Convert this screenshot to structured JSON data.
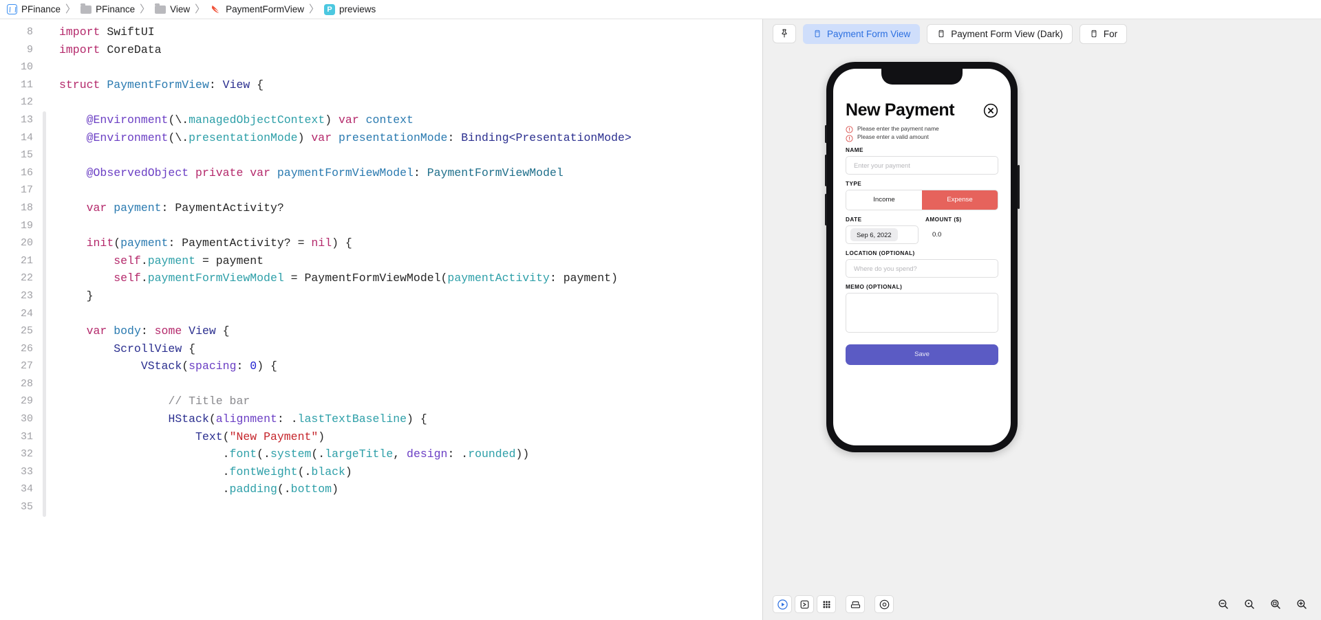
{
  "breadcrumb": {
    "items": [
      {
        "icon": "app-icon",
        "label": "PFinance"
      },
      {
        "icon": "folder-icon",
        "label": "PFinance"
      },
      {
        "icon": "folder-icon",
        "label": "View"
      },
      {
        "icon": "swift-icon",
        "label": "PaymentFormView"
      },
      {
        "icon": "preview-icon",
        "label": "previews"
      }
    ],
    "separator": "〉"
  },
  "editor": {
    "first_line_number": 8,
    "lines": [
      {
        "n": 8,
        "tokens": [
          {
            "t": "import",
            "c": "kw"
          },
          {
            "t": " SwiftUI",
            "c": "pln"
          }
        ]
      },
      {
        "n": 9,
        "tokens": [
          {
            "t": "import",
            "c": "kw"
          },
          {
            "t": " CoreData",
            "c": "pln"
          }
        ]
      },
      {
        "n": 10,
        "tokens": []
      },
      {
        "n": 11,
        "tokens": [
          {
            "t": "struct",
            "c": "kw"
          },
          {
            "t": " ",
            "c": "pln"
          },
          {
            "t": "PaymentFormView",
            "c": "var"
          },
          {
            "t": ": ",
            "c": "pln"
          },
          {
            "t": "View",
            "c": "typ"
          },
          {
            "t": " {",
            "c": "pln"
          }
        ]
      },
      {
        "n": 12,
        "tokens": []
      },
      {
        "n": 13,
        "tokens": [
          {
            "t": "    ",
            "c": "pln"
          },
          {
            "t": "@Environment",
            "c": "attr"
          },
          {
            "t": "(\\.",
            "c": "pln"
          },
          {
            "t": "managedObjectContext",
            "c": "prop"
          },
          {
            "t": ") ",
            "c": "pln"
          },
          {
            "t": "var",
            "c": "kw"
          },
          {
            "t": " ",
            "c": "pln"
          },
          {
            "t": "context",
            "c": "var"
          }
        ]
      },
      {
        "n": 14,
        "tokens": [
          {
            "t": "    ",
            "c": "pln"
          },
          {
            "t": "@Environment",
            "c": "attr"
          },
          {
            "t": "(\\.",
            "c": "pln"
          },
          {
            "t": "presentationMode",
            "c": "prop"
          },
          {
            "t": ") ",
            "c": "pln"
          },
          {
            "t": "var",
            "c": "kw"
          },
          {
            "t": " ",
            "c": "pln"
          },
          {
            "t": "presentationMode",
            "c": "var"
          },
          {
            "t": ": ",
            "c": "pln"
          },
          {
            "t": "Binding<PresentationMode>",
            "c": "typ"
          }
        ]
      },
      {
        "n": 15,
        "tokens": []
      },
      {
        "n": 16,
        "tokens": [
          {
            "t": "    ",
            "c": "pln"
          },
          {
            "t": "@ObservedObject",
            "c": "attr"
          },
          {
            "t": " ",
            "c": "pln"
          },
          {
            "t": "private",
            "c": "kw"
          },
          {
            "t": " ",
            "c": "kw"
          },
          {
            "t": "var",
            "c": "kw"
          },
          {
            "t": " ",
            "c": "pln"
          },
          {
            "t": "paymentFormViewModel",
            "c": "var"
          },
          {
            "t": ": ",
            "c": "pln"
          },
          {
            "t": "PaymentFormViewModel",
            "c": "cls"
          }
        ]
      },
      {
        "n": 17,
        "tokens": []
      },
      {
        "n": 18,
        "tokens": [
          {
            "t": "    ",
            "c": "pln"
          },
          {
            "t": "var",
            "c": "kw"
          },
          {
            "t": " ",
            "c": "pln"
          },
          {
            "t": "payment",
            "c": "var"
          },
          {
            "t": ": ",
            "c": "pln"
          },
          {
            "t": "PaymentActivity?",
            "c": "pln"
          }
        ]
      },
      {
        "n": 19,
        "tokens": []
      },
      {
        "n": 20,
        "tokens": [
          {
            "t": "    ",
            "c": "pln"
          },
          {
            "t": "init",
            "c": "kw"
          },
          {
            "t": "(",
            "c": "pln"
          },
          {
            "t": "payment",
            "c": "var"
          },
          {
            "t": ": ",
            "c": "pln"
          },
          {
            "t": "PaymentActivity? = ",
            "c": "pln"
          },
          {
            "t": "nil",
            "c": "kw"
          },
          {
            "t": ") {",
            "c": "pln"
          }
        ]
      },
      {
        "n": 21,
        "tokens": [
          {
            "t": "        ",
            "c": "pln"
          },
          {
            "t": "self",
            "c": "kw"
          },
          {
            "t": ".",
            "c": "pln"
          },
          {
            "t": "payment",
            "c": "prop"
          },
          {
            "t": " = payment",
            "c": "pln"
          }
        ]
      },
      {
        "n": 22,
        "tokens": [
          {
            "t": "        ",
            "c": "pln"
          },
          {
            "t": "self",
            "c": "kw"
          },
          {
            "t": ".",
            "c": "pln"
          },
          {
            "t": "paymentFormViewModel",
            "c": "prop"
          },
          {
            "t": " = PaymentFormViewModel(",
            "c": "pln"
          },
          {
            "t": "paymentActivity",
            "c": "prop"
          },
          {
            "t": ": payment)",
            "c": "pln"
          }
        ]
      },
      {
        "n": 23,
        "tokens": [
          {
            "t": "    }",
            "c": "pln"
          }
        ]
      },
      {
        "n": 24,
        "tokens": []
      },
      {
        "n": 25,
        "tokens": [
          {
            "t": "    ",
            "c": "pln"
          },
          {
            "t": "var",
            "c": "kw"
          },
          {
            "t": " ",
            "c": "pln"
          },
          {
            "t": "body",
            "c": "var"
          },
          {
            "t": ": ",
            "c": "pln"
          },
          {
            "t": "some",
            "c": "kw"
          },
          {
            "t": " ",
            "c": "pln"
          },
          {
            "t": "View",
            "c": "typ"
          },
          {
            "t": " {",
            "c": "pln"
          }
        ]
      },
      {
        "n": 26,
        "tokens": [
          {
            "t": "        ",
            "c": "pln"
          },
          {
            "t": "ScrollView",
            "c": "typ"
          },
          {
            "t": " {",
            "c": "pln"
          }
        ]
      },
      {
        "n": 27,
        "tokens": [
          {
            "t": "            ",
            "c": "pln"
          },
          {
            "t": "VStack",
            "c": "typ"
          },
          {
            "t": "(",
            "c": "pln"
          },
          {
            "t": "spacing",
            "c": "attr"
          },
          {
            "t": ": ",
            "c": "pln"
          },
          {
            "t": "0",
            "c": "num"
          },
          {
            "t": ") {",
            "c": "pln"
          }
        ]
      },
      {
        "n": 28,
        "tokens": []
      },
      {
        "n": 29,
        "tokens": [
          {
            "t": "                ",
            "c": "pln"
          },
          {
            "t": "// Title bar",
            "c": "cmt"
          }
        ]
      },
      {
        "n": 30,
        "tokens": [
          {
            "t": "                ",
            "c": "pln"
          },
          {
            "t": "HStack",
            "c": "typ"
          },
          {
            "t": "(",
            "c": "pln"
          },
          {
            "t": "alignment",
            "c": "attr"
          },
          {
            "t": ": .",
            "c": "pln"
          },
          {
            "t": "lastTextBaseline",
            "c": "prop"
          },
          {
            "t": ") {",
            "c": "pln"
          }
        ]
      },
      {
        "n": 31,
        "tokens": [
          {
            "t": "                    ",
            "c": "pln"
          },
          {
            "t": "Text",
            "c": "typ"
          },
          {
            "t": "(",
            "c": "pln"
          },
          {
            "t": "\"New Payment\"",
            "c": "str"
          },
          {
            "t": ")",
            "c": "pln"
          }
        ]
      },
      {
        "n": 32,
        "tokens": [
          {
            "t": "                        .",
            "c": "pln"
          },
          {
            "t": "font",
            "c": "prop"
          },
          {
            "t": "(.",
            "c": "pln"
          },
          {
            "t": "system",
            "c": "prop"
          },
          {
            "t": "(.",
            "c": "pln"
          },
          {
            "t": "largeTitle",
            "c": "prop"
          },
          {
            "t": ", ",
            "c": "pln"
          },
          {
            "t": "design",
            "c": "attr"
          },
          {
            "t": ": .",
            "c": "pln"
          },
          {
            "t": "rounded",
            "c": "prop"
          },
          {
            "t": "))",
            "c": "pln"
          }
        ]
      },
      {
        "n": 33,
        "tokens": [
          {
            "t": "                        .",
            "c": "pln"
          },
          {
            "t": "fontWeight",
            "c": "prop"
          },
          {
            "t": "(.",
            "c": "pln"
          },
          {
            "t": "black",
            "c": "prop"
          },
          {
            "t": ")",
            "c": "pln"
          }
        ]
      },
      {
        "n": 34,
        "tokens": [
          {
            "t": "                        .",
            "c": "pln"
          },
          {
            "t": "padding",
            "c": "prop"
          },
          {
            "t": "(.",
            "c": "pln"
          },
          {
            "t": "bottom",
            "c": "prop"
          },
          {
            "t": ")",
            "c": "pln"
          }
        ]
      },
      {
        "n": 35,
        "tokens": []
      }
    ]
  },
  "canvas": {
    "pin_button": {
      "name": "pin-preview",
      "icon": "pin-icon"
    },
    "tabs": [
      {
        "label": "Payment Form View",
        "icon": "device-icon",
        "active": true
      },
      {
        "label": "Payment Form View (Dark)",
        "icon": "device-icon",
        "active": false
      },
      {
        "label": "For",
        "icon": "device-icon",
        "active": false
      }
    ],
    "bottom_toolbar": {
      "left_buttons": [
        {
          "name": "play-preview-button",
          "icon": "play-circle-icon"
        },
        {
          "name": "live-preview-button",
          "icon": "export-box-icon"
        },
        {
          "name": "variants-button",
          "icon": "grid-icon"
        },
        {
          "name": "device-settings-button",
          "icon": "device-stack-icon"
        },
        {
          "name": "inspect-button",
          "icon": "target-icon"
        }
      ],
      "zoom_buttons": [
        {
          "name": "zoom-out-button",
          "icon": "zoom-out-icon"
        },
        {
          "name": "zoom-reset-button",
          "icon": "zoom-reset-icon"
        },
        {
          "name": "zoom-fit-button",
          "icon": "zoom-fit-icon"
        },
        {
          "name": "zoom-in-button",
          "icon": "zoom-in-icon"
        }
      ]
    }
  },
  "preview": {
    "title": "New Payment",
    "close_icon": "close-circle-icon",
    "errors": [
      {
        "icon": "info-circle-icon",
        "text": "Please enter the payment name"
      },
      {
        "icon": "info-circle-icon",
        "text": "Please enter a valid amount"
      }
    ],
    "fields": {
      "name_label": "NAME",
      "name_placeholder": "Enter your payment",
      "type_label": "TYPE",
      "type_options": [
        {
          "label": "Income",
          "selected": false
        },
        {
          "label": "Expense",
          "selected": true
        }
      ],
      "date_label": "DATE",
      "date_value": "Sep 6, 2022",
      "amount_label": "AMOUNT ($)",
      "amount_value": "0.0",
      "location_label": "LOCATION (OPTIONAL)",
      "location_placeholder": "Where do you spend?",
      "memo_label": "MEMO (OPTIONAL)",
      "memo_value": ""
    },
    "save_label": "Save"
  },
  "colors": {
    "accent_blue": "#2b6fe0",
    "tab_active_bg": "#cfdefb",
    "expense_red": "#e6635c",
    "save_purple": "#5b5bc4",
    "error_red": "#d9534f",
    "canvas_bg": "#f0f0f0"
  }
}
